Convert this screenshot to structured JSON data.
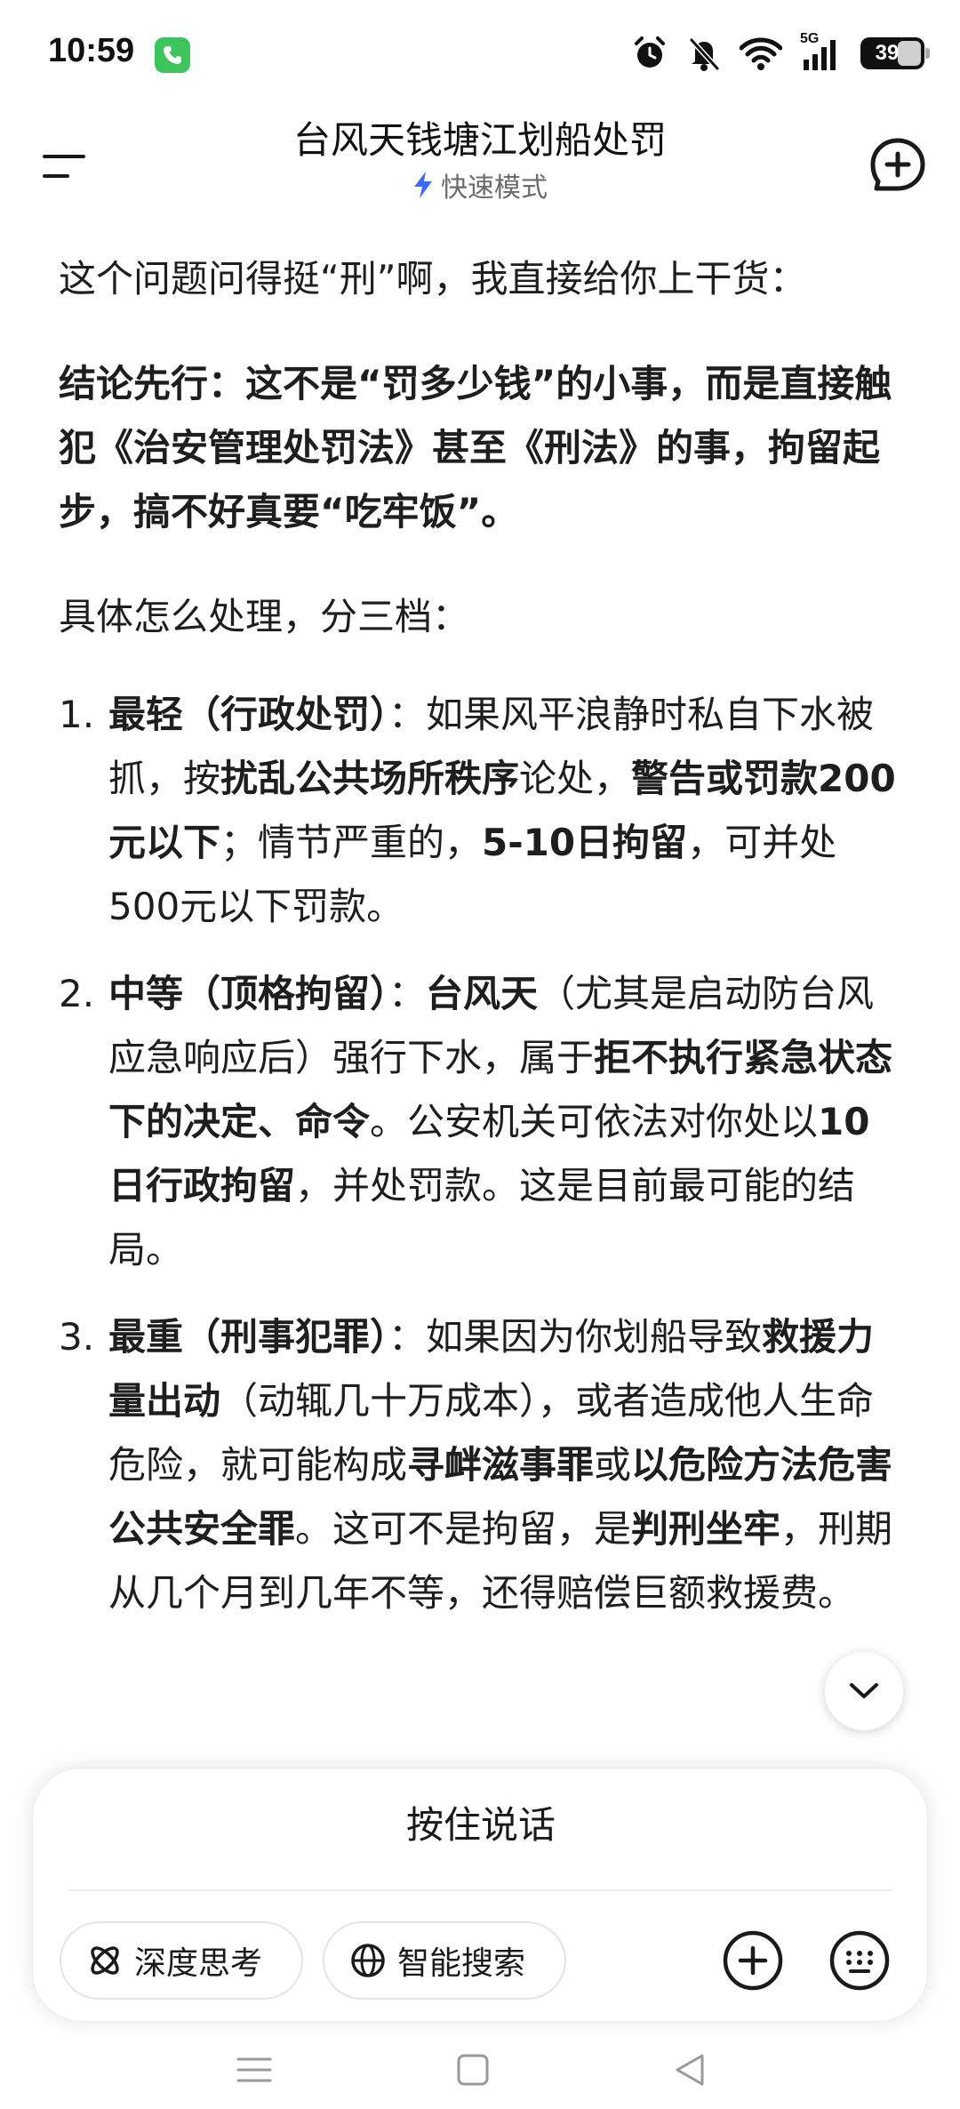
{
  "status_bar": {
    "time": "10:59",
    "network": "5G",
    "battery_level": "39",
    "icons": [
      "phone-icon",
      "alarm-icon",
      "mute-bell-icon",
      "wifi-icon",
      "signal-icon",
      "battery-icon"
    ]
  },
  "header": {
    "title": "台风天钱塘江划船处罚",
    "mode_label": "快速模式",
    "accent_color": "#3b6cf6"
  },
  "messages": {
    "intro": "这个问题问得挺“刑”啊，我直接给你上干货：",
    "conclusion": "结论先行：这不是“罚多少钱”的小事，而是直接触犯《治安管理处罚法》甚至《刑法》的事，拘留起步，搞不好真要“吃牢饭”。",
    "lead": "具体怎么处理，分三档：",
    "items": [
      {
        "num": "1.",
        "title": "最轻（行政处罚）",
        "sep": "：",
        "t1": "如果风平浪静时私自下水被抓，按",
        "b1": "扰乱公共场所秩序",
        "t2": "论处，",
        "b2": "警告或罚款200元以下",
        "t3": "；情节严重的，",
        "b3": "5-10日拘留",
        "t4": "，可并处500元以下罚款。"
      },
      {
        "num": "2.",
        "title": "中等（顶格拘留）",
        "sep": "：",
        "b1": "台风天",
        "t1": "（尤其是启动防台风应急响应后）强行下水，属于",
        "b2": "拒不执行紧急状态下的决定、命令",
        "t2": "。公安机关可依法对你处以",
        "b3": "10日行政拘留",
        "t3": "，并处罚款。这是目前最可能的结局。"
      },
      {
        "num": "3.",
        "title": "最重（刑事犯罪）",
        "sep": "：",
        "t1": "如果因为你划船导致",
        "b1": "救援力量出动",
        "t2": "（动辄几十万成本），或者造成他人生命危险，就可能构成",
        "b2": "寻衅滋事罪",
        "t3": "或",
        "b3": "以危险方法危害公共安全罪",
        "t4": "。这可不是拘留，是",
        "b4": "判刑坐牢",
        "t5": "，刑期从几个月到几年不等，还得赔偿巨额救援费。"
      }
    ]
  },
  "input_panel": {
    "voice_label": "按住说话",
    "deep_think_label": "深度思考",
    "smart_search_label": "智能搜索"
  }
}
